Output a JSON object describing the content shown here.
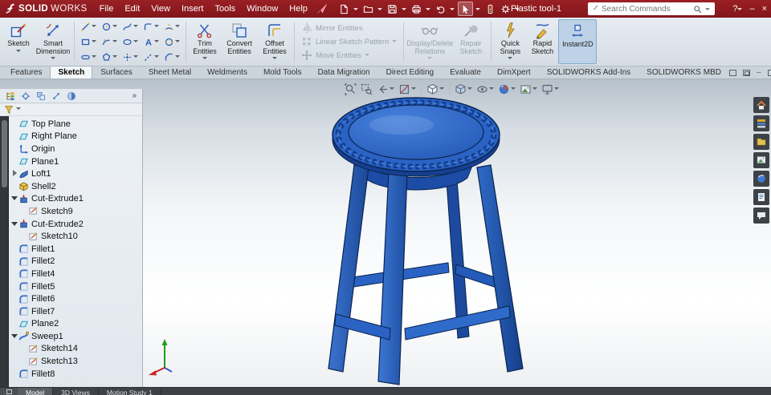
{
  "titlebar": {
    "brand": {
      "solid": "SOLID",
      "works": "WORKS"
    },
    "menus": [
      "File",
      "Edit",
      "View",
      "Insert",
      "Tools",
      "Window",
      "Help"
    ],
    "quick_toolbar_icons": [
      "new-document",
      "open-folder",
      "save",
      "print",
      "undo",
      "select-cursor",
      "rebuild",
      "options-gear"
    ],
    "document_title": "Plastic tool-1",
    "search": {
      "placeholder": "Search Commands"
    },
    "window_controls": {
      "help": "?",
      "minimize": "–",
      "close": "×"
    }
  },
  "ribbon": {
    "buttons": {
      "sketch": "Sketch",
      "smart_dimension": "Smart Dimension",
      "trim_entities": "Trim Entities",
      "convert_entities": "Convert Entities",
      "offset_entities": "Offset Entities",
      "mirror_entities": "Mirror Entities",
      "linear_sketch_pattern": "Linear Sketch Pattern",
      "move_entities": "Move Entities",
      "display_delete_relations": "Display/Delete Relations",
      "repair_sketch": "Repair Sketch",
      "quick_snaps": "Quick Snaps",
      "rapid_sketch": "Rapid Sketch",
      "instant2d": "Instant2D"
    },
    "sketch_entity_icons": [
      "line",
      "corner-rectangle",
      "straight-slot",
      "circle",
      "centerpoint-arc",
      "polygon",
      "spline",
      "ellipse",
      "point",
      "sketch-fillet",
      "text",
      "centerline",
      "three-point-arc",
      "perimeter-circle",
      "sketch-chamfer"
    ],
    "disabled_buttons": [
      "mirror_entities",
      "linear_sketch_pattern",
      "move_entities",
      "display_delete_relations",
      "repair_sketch"
    ],
    "active_button": "instant2d"
  },
  "command_tabs": {
    "items": [
      "Features",
      "Sketch",
      "Surfaces",
      "Sheet Metal",
      "Weldments",
      "Mold Tools",
      "Data Migration",
      "Direct Editing",
      "Evaluate",
      "DimXpert",
      "SOLIDWORKS Add-Ins",
      "SOLIDWORKS MBD"
    ],
    "active": "Sketch"
  },
  "feature_tree": {
    "items": [
      {
        "label": "Top Plane",
        "icon": "plane"
      },
      {
        "label": "Right Plane",
        "icon": "plane"
      },
      {
        "label": "Origin",
        "icon": "origin"
      },
      {
        "label": "Plane1",
        "icon": "plane"
      },
      {
        "label": "Loft1",
        "icon": "loft",
        "state": "collapsed"
      },
      {
        "label": "Shell2",
        "icon": "shell"
      },
      {
        "label": "Cut-Extrude1",
        "icon": "cut-extrude",
        "state": "expanded"
      },
      {
        "label": "Sketch9",
        "icon": "sketch",
        "child": true
      },
      {
        "label": "Cut-Extrude2",
        "icon": "cut-extrude",
        "state": "expanded"
      },
      {
        "label": "Sketch10",
        "icon": "sketch",
        "child": true
      },
      {
        "label": "Fillet1",
        "icon": "fillet"
      },
      {
        "label": "Fillet2",
        "icon": "fillet"
      },
      {
        "label": "Fillet4",
        "icon": "fillet"
      },
      {
        "label": "Fillet5",
        "icon": "fillet"
      },
      {
        "label": "Fillet6",
        "icon": "fillet"
      },
      {
        "label": "Fillet7",
        "icon": "fillet"
      },
      {
        "label": "Plane2",
        "icon": "plane"
      },
      {
        "label": "Sweep1",
        "icon": "sweep",
        "state": "expanded"
      },
      {
        "label": "Sketch14",
        "icon": "sketch",
        "child": true
      },
      {
        "label": "Sketch13",
        "icon": "sketch",
        "child": true
      },
      {
        "label": "Fillet8",
        "icon": "fillet"
      }
    ]
  },
  "viewport": {
    "hud_icons": [
      "zoom-to-fit",
      "zoom-to-area",
      "previous-view",
      "section-view",
      "view-orientation",
      "display-style",
      "hide-show-items",
      "edit-appearance",
      "apply-scene",
      "view-settings"
    ],
    "model": {
      "name": "stool",
      "color": "#2a63c4"
    }
  },
  "task_pane_icons": [
    "home",
    "design-library",
    "file-explorer",
    "view-palette",
    "appearances",
    "custom-properties",
    "forum"
  ],
  "status_tabs": {
    "items": [
      "Model",
      "3D Views",
      "Motion Study 1"
    ],
    "active": "Model"
  },
  "colors": {
    "titlebar_red": "#8e191c",
    "model_blue": "#2a63c4",
    "ribbon_bg": "#dde4eb"
  }
}
